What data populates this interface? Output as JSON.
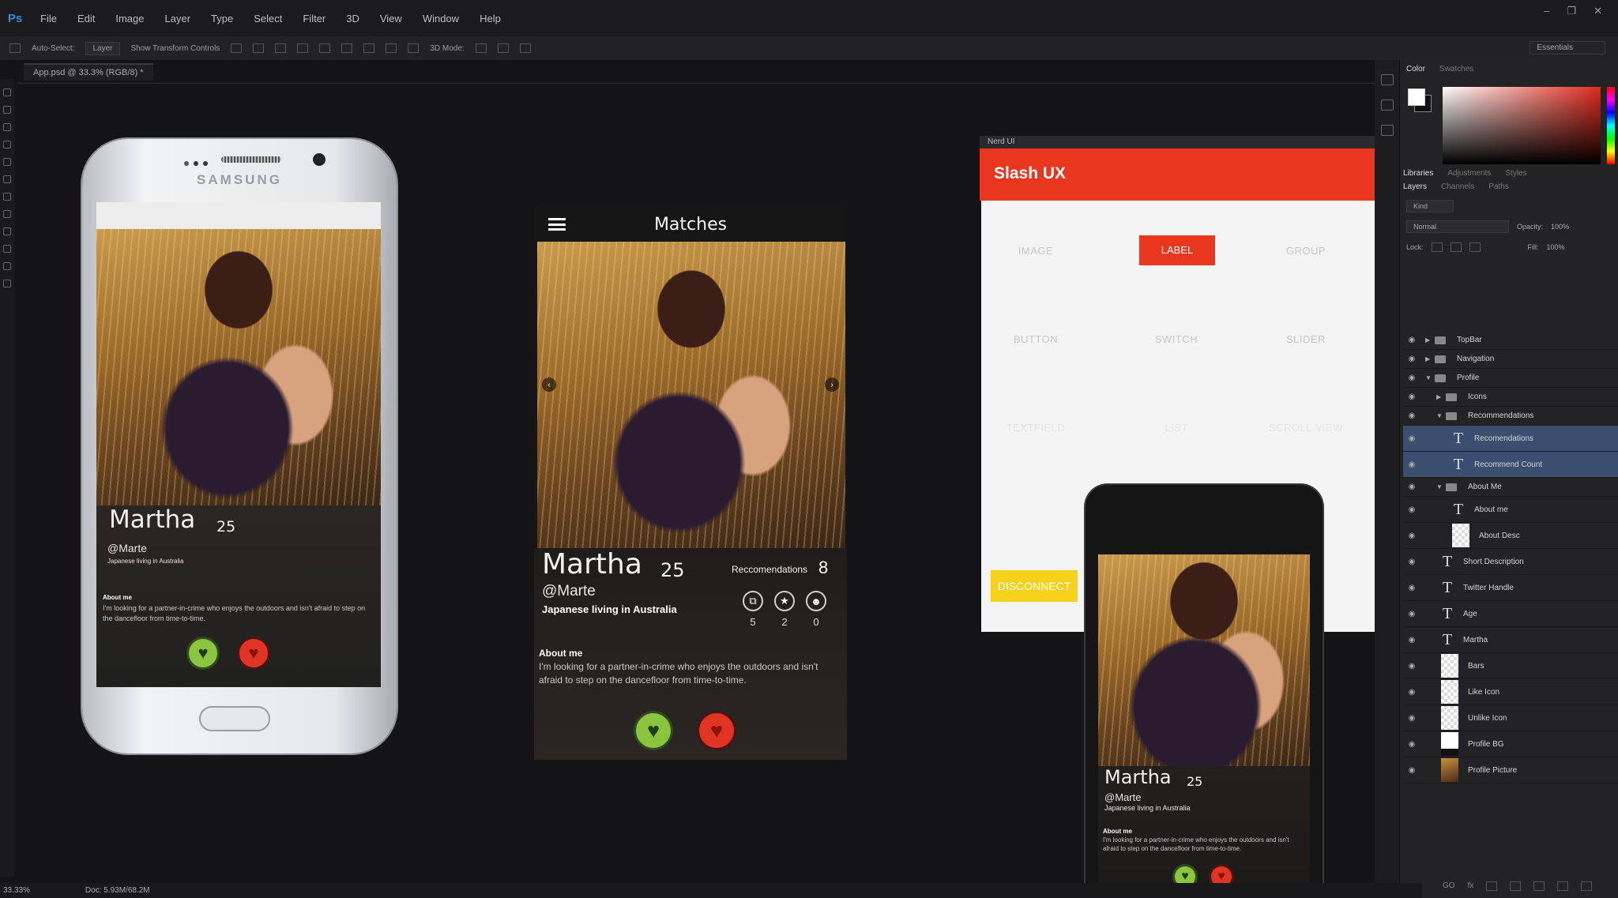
{
  "app": {
    "logo": "Ps",
    "menu": [
      "File",
      "Edit",
      "Image",
      "Layer",
      "Type",
      "Select",
      "Filter",
      "3D",
      "View",
      "Window",
      "Help"
    ],
    "window_controls": [
      "–",
      "❐",
      "✕"
    ]
  },
  "options_bar": {
    "auto_select_label": "Auto-Select:",
    "auto_select_value": "Layer",
    "transform_label": "Show Transform Controls",
    "mode_3d": "3D Mode:",
    "workspace": "Essentials"
  },
  "document": {
    "tab_label": "App.psd @ 33.3% (RGB/8) *",
    "zoom": "33.33%",
    "doc_size": "Doc: 5.93M/68.2M"
  },
  "panels": {
    "color_tabs": [
      "Color",
      "Swatches"
    ],
    "library_tabs": [
      "Libraries",
      "Adjustments",
      "Styles"
    ],
    "layer_tabs": [
      "Layers",
      "Channels",
      "Paths"
    ],
    "kind": "Kind",
    "blend_mode": "Normal",
    "opacity_label": "Opacity:",
    "opacity_value": "100%",
    "lock_label": "Lock:",
    "fill_label": "Fill:",
    "fill_value": "100%",
    "footer_icons": [
      "GO",
      "fx"
    ]
  },
  "layers": [
    {
      "name": "TopBar",
      "kind": "folder",
      "depth": 0,
      "expanded": false,
      "selected": false
    },
    {
      "name": "Navigation",
      "kind": "folder",
      "depth": 0,
      "expanded": false,
      "selected": false
    },
    {
      "name": "Profile",
      "kind": "folder",
      "depth": 0,
      "expanded": true,
      "selected": false
    },
    {
      "name": "Icons",
      "kind": "folder",
      "depth": 1,
      "expanded": false,
      "selected": false
    },
    {
      "name": "Recommendations",
      "kind": "folder",
      "depth": 1,
      "expanded": true,
      "selected": false
    },
    {
      "name": "Recomendations",
      "kind": "text",
      "depth": 2,
      "selected": true
    },
    {
      "name": "Recommend Count",
      "kind": "text",
      "depth": 2,
      "selected": true
    },
    {
      "name": "About Me",
      "kind": "folder",
      "depth": 1,
      "expanded": true,
      "selected": false
    },
    {
      "name": "About me",
      "kind": "text",
      "depth": 2,
      "selected": false
    },
    {
      "name": "About Desc",
      "kind": "pixel",
      "depth": 2,
      "selected": false
    },
    {
      "name": "Short Description",
      "kind": "text",
      "depth": 1,
      "selected": false
    },
    {
      "name": "Twitter Handle",
      "kind": "text",
      "depth": 1,
      "selected": false
    },
    {
      "name": "Age",
      "kind": "text",
      "depth": 1,
      "selected": false
    },
    {
      "name": "Martha",
      "kind": "text",
      "depth": 1,
      "selected": false
    },
    {
      "name": "Bars",
      "kind": "pixel",
      "depth": 1,
      "selected": false
    },
    {
      "name": "Like Icon",
      "kind": "pixel",
      "depth": 1,
      "selected": false
    },
    {
      "name": "Unlike Icon",
      "kind": "pixel",
      "depth": 1,
      "selected": false
    },
    {
      "name": "Profile BG",
      "kind": "dark",
      "depth": 1,
      "selected": false
    },
    {
      "name": "Profile Picture",
      "kind": "photo",
      "depth": 1,
      "selected": false
    }
  ],
  "profile": {
    "name": "Martha",
    "age": "25",
    "handle": "@Marte",
    "short_desc": "Japanese living in Australia",
    "about_title": "About me",
    "about_text": "I'm looking for a partner-in-crime who enjoys the outdoors and isn't afraid to step on the dancefloor from time-to-time.",
    "samsung_about_title": "About me",
    "samsung_about_text": "I'm looking for a partner-in-crime who enjoys the outdoors and isn't afraid to step on the dancefloor from time-to-time."
  },
  "samsung": {
    "brand": "SAMSUNG"
  },
  "matches": {
    "title": "Matches",
    "recommendations_label": "Reccomendations",
    "recommendations_count": "8",
    "stats": [
      {
        "icon": "copy-icon",
        "glyph": "⧉",
        "count": "5"
      },
      {
        "icon": "star-icon",
        "glyph": "★",
        "count": "2"
      },
      {
        "icon": "group-icon",
        "glyph": "☻",
        "count": "0"
      }
    ],
    "prev_glyph": "‹",
    "next_glyph": "›"
  },
  "heart_glyph": "♥",
  "nerd_ui": {
    "window_title": "Nerd UI",
    "title": "Slash UX",
    "items_row1": [
      "IMAGE",
      "LABEL",
      "GROUP"
    ],
    "items_row2": [
      "BUTTON",
      "SWITCH",
      "SLIDER"
    ],
    "items_row3": [
      "TEXTFIELD",
      "LIST",
      "SCROLL VIEW"
    ],
    "disconnect": "DISCONNECT"
  },
  "colors": {
    "accent_red": "#e8361f",
    "disconnect_yellow": "#f6d21a",
    "like_green": "#8bc53f",
    "unlike_red": "#e03424",
    "layer_selected": "#3a4f70"
  }
}
